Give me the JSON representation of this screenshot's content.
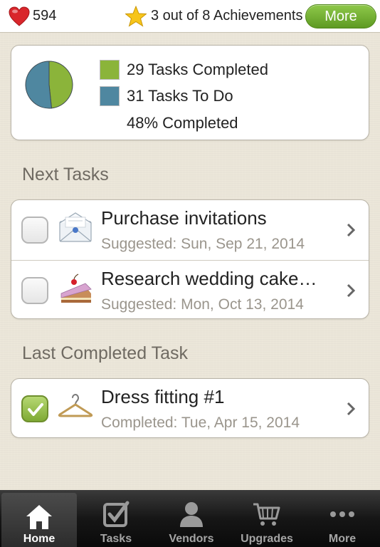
{
  "topbar": {
    "hearts_count": "594",
    "achievements_text": "3 out of 8 Achievements",
    "more_label": "More"
  },
  "chart_data": {
    "type": "pie",
    "categories": [
      "Tasks Completed",
      "Tasks To Do"
    ],
    "values": [
      29,
      31
    ],
    "colors": [
      "#8bb43a",
      "#4f87a0"
    ]
  },
  "summary": {
    "completed_label": "29 Tasks Completed",
    "todo_label": "31 Tasks To Do",
    "percent_label": "48% Completed"
  },
  "next_tasks": {
    "title": "Next Tasks",
    "items": [
      {
        "title": "Purchase invitations",
        "subtitle": "Suggested: Sun, Sep 21, 2014",
        "icon": "envelope-icon"
      },
      {
        "title": "Research wedding cake…",
        "subtitle": "Suggested: Mon, Oct 13, 2014",
        "icon": "cake-icon"
      }
    ]
  },
  "last_completed": {
    "title": "Last Completed Task",
    "item": {
      "title": "Dress fitting #1",
      "subtitle": "Completed: Tue, Apr 15, 2014",
      "icon": "hanger-icon"
    }
  },
  "tabs": [
    {
      "label": "Home",
      "icon": "home-icon",
      "active": true
    },
    {
      "label": "Tasks",
      "icon": "checkbox-icon",
      "active": false
    },
    {
      "label": "Vendors",
      "icon": "person-icon",
      "active": false
    },
    {
      "label": "Upgrades",
      "icon": "cart-icon",
      "active": false
    },
    {
      "label": "More",
      "icon": "ellipsis-icon",
      "active": false
    }
  ]
}
